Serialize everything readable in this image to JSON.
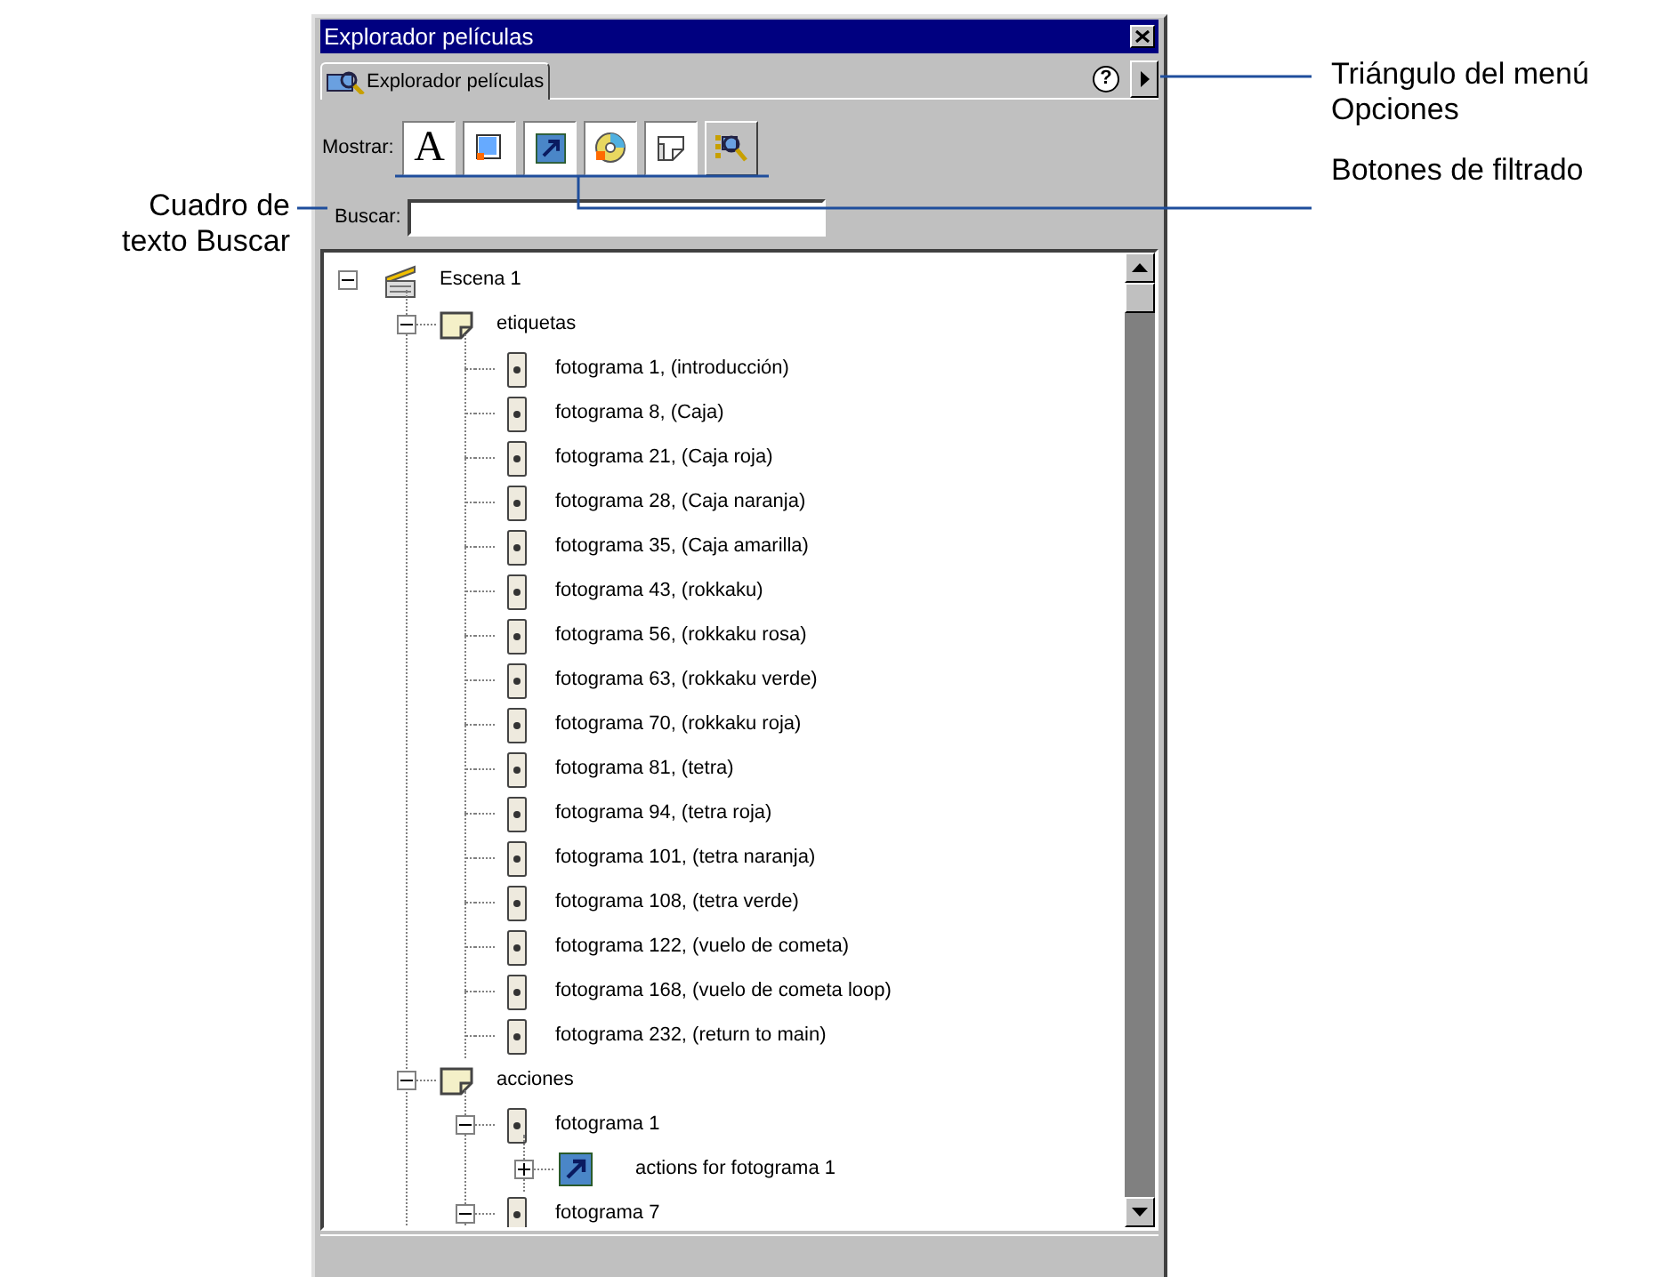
{
  "annotations": {
    "left": [
      "Cuadro de",
      "texto Buscar"
    ],
    "right_top": [
      "Triángulo del menú",
      "Opciones"
    ],
    "right_bottom": [
      "Botones de filtrado"
    ]
  },
  "window": {
    "title": "Explorador películas"
  },
  "tabs": [
    {
      "label": "Explorador películas",
      "selected": true
    }
  ],
  "help": "?",
  "filter": {
    "label": "Mostrar:",
    "buttons": [
      {
        "kind": "text",
        "label": "A",
        "on": true
      },
      {
        "kind": "button",
        "on": true
      },
      {
        "kind": "action",
        "on": true
      },
      {
        "kind": "movie",
        "on": true
      },
      {
        "kind": "frame",
        "on": true
      },
      {
        "kind": "custom",
        "on": false
      }
    ]
  },
  "search": {
    "label": "Buscar:"
  },
  "tree": [
    {
      "kind": "scene",
      "label": "Escena 1",
      "expanded": true,
      "children": [
        {
          "kind": "layer",
          "label": "etiquetas",
          "expanded": true,
          "children": [
            {
              "kind": "frame",
              "label": "fotograma 1, (introducción)"
            },
            {
              "kind": "frame",
              "label": "fotograma 8, (Caja)"
            },
            {
              "kind": "frame",
              "label": "fotograma 21, (Caja roja)"
            },
            {
              "kind": "frame",
              "label": "fotograma 28, (Caja naranja)"
            },
            {
              "kind": "frame",
              "label": "fotograma 35, (Caja amarilla)"
            },
            {
              "kind": "frame",
              "label": "fotograma 43, (rokkaku)"
            },
            {
              "kind": "frame",
              "label": "fotograma 56, (rokkaku rosa)"
            },
            {
              "kind": "frame",
              "label": "fotograma 63, (rokkaku verde)"
            },
            {
              "kind": "frame",
              "label": "fotograma 70, (rokkaku roja)"
            },
            {
              "kind": "frame",
              "label": "fotograma 81, (tetra)"
            },
            {
              "kind": "frame",
              "label": "fotograma 94, (tetra roja)"
            },
            {
              "kind": "frame",
              "label": "fotograma 101, (tetra naranja)"
            },
            {
              "kind": "frame",
              "label": "fotograma 108, (tetra verde)"
            },
            {
              "kind": "frame",
              "label": "fotograma 122, (vuelo de cometa)"
            },
            {
              "kind": "frame",
              "label": "fotograma 168, (vuelo de cometa loop)"
            },
            {
              "kind": "frame",
              "label": "fotograma 232, (return to main)"
            }
          ]
        },
        {
          "kind": "layer",
          "label": "acciones",
          "expanded": true,
          "children": [
            {
              "kind": "frame",
              "label": "fotograma 1",
              "expanded": true,
              "children": [
                {
                  "kind": "action",
                  "label": "actions for fotograma 1",
                  "expanded": false
                }
              ]
            },
            {
              "kind": "frame",
              "label": "fotograma 7",
              "expanded": true
            }
          ]
        }
      ]
    }
  ]
}
